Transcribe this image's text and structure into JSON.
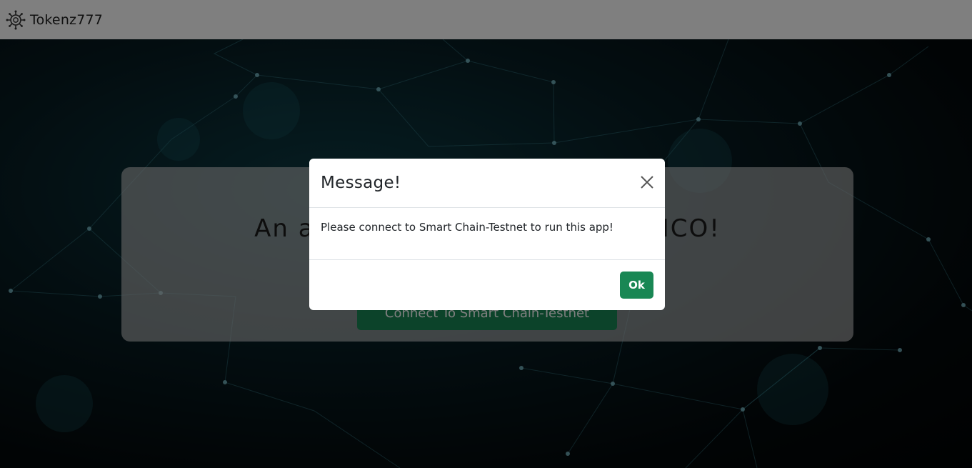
{
  "navbar": {
    "brand_name": "Tokenz777",
    "brand_icon": "token-gear-icon"
  },
  "hero": {
    "title": "An application to launch your ICO!",
    "connect_button_label": "Connect To Smart Chain-Testnet"
  },
  "modal": {
    "title": "Message!",
    "body_text": "Please connect to Smart Chain-Testnet to run this app!",
    "ok_label": "Ok",
    "close_icon": "close-icon"
  },
  "colors": {
    "accent_green": "#198754",
    "navbar_bg": "#ffffff",
    "hero_bg": "#071c22"
  }
}
